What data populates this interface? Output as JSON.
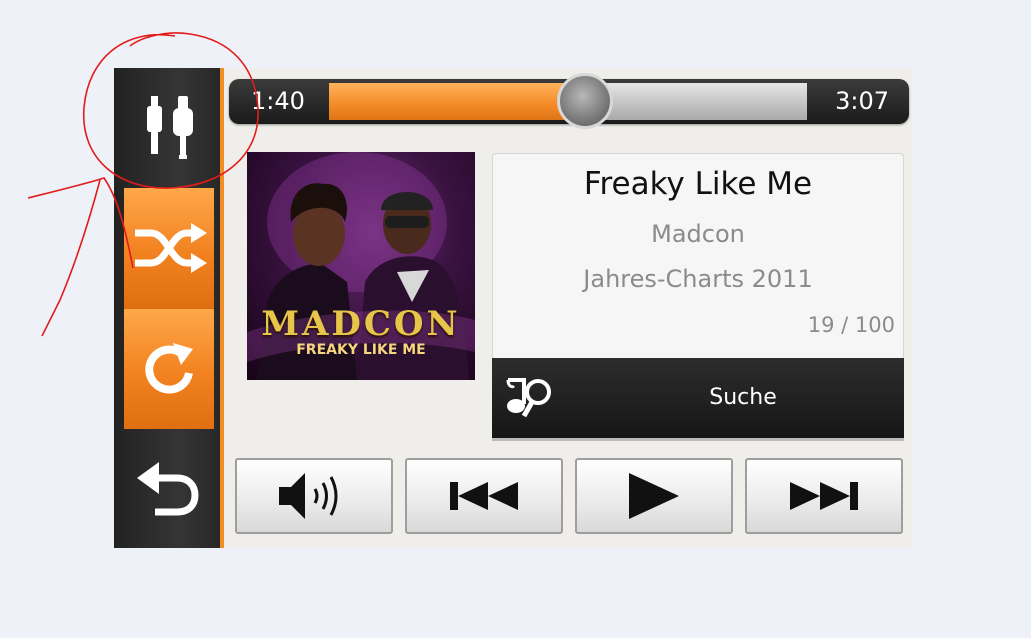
{
  "sidebar": {
    "items": [
      {
        "icon": "audio-plugs-icon"
      },
      {
        "icon": "shuffle-icon"
      },
      {
        "icon": "repeat-icon"
      },
      {
        "icon": "back-arrow-icon"
      }
    ]
  },
  "player": {
    "current_time": "1:40",
    "total_time": "3:07",
    "progress": 0.535
  },
  "album_art": {
    "logo_text": "MADCON",
    "subtitle_text": "FREAKY LIKE ME"
  },
  "track": {
    "title": "Freaky Like Me",
    "artist": "Madcon",
    "album": "Jahres-Charts 2011",
    "position": "19 / 100"
  },
  "search": {
    "label": "Suche",
    "icon": "music-search-icon"
  },
  "controls": [
    {
      "icon": "volume-icon"
    },
    {
      "icon": "previous-track-icon"
    },
    {
      "icon": "play-icon"
    },
    {
      "icon": "next-track-icon"
    }
  ],
  "colors": {
    "accent": "#f28c25",
    "sidebar": "#2c2c2c",
    "annotation": "#e31b1b"
  }
}
